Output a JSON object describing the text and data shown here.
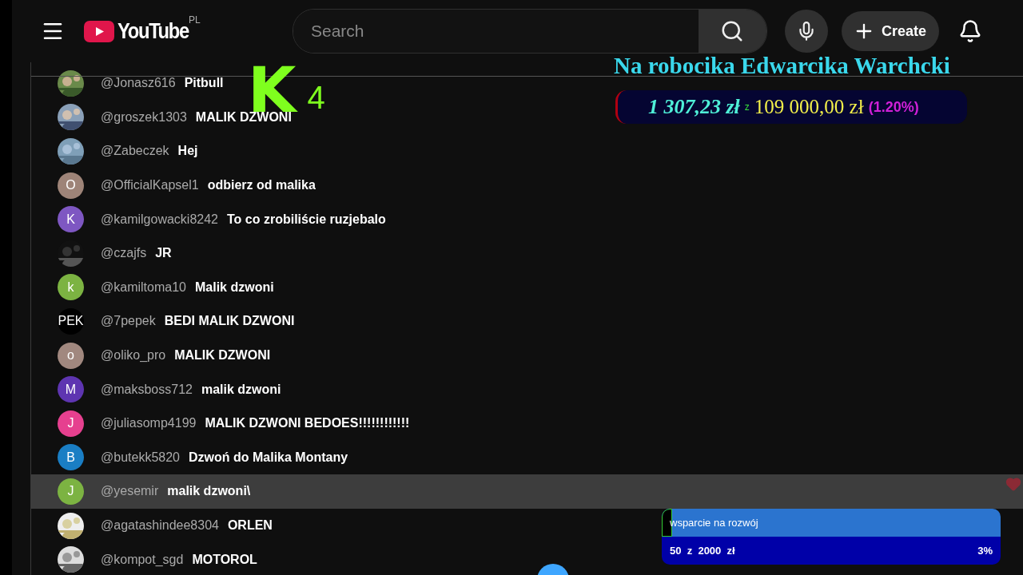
{
  "header": {
    "logo_text": "YouTube",
    "region": "PL",
    "search": {
      "placeholder": "Search"
    },
    "create_label": "Create"
  },
  "chat": {
    "messages": [
      {
        "author": "@Jonasz616",
        "text": "Pitbull",
        "selected": false
      },
      {
        "author": "@groszek1303",
        "text": "MALIK DZWONI",
        "selected": false
      },
      {
        "author": "@Zabeczek",
        "text": "Hej",
        "selected": false
      },
      {
        "author": "@OfficialKapsel1",
        "text": "odbierz od malika",
        "avatar": {
          "kind": "letter",
          "letter": "O",
          "color": "#9e8478"
        },
        "selected": false
      },
      {
        "author": "@kamilgowacki8242",
        "text": "To co zrobiliście ruzjebalo",
        "avatar": {
          "kind": "letter",
          "letter": "K",
          "color": "#7e57c2"
        },
        "selected": false
      },
      {
        "author": "@czajfs",
        "text": "JR",
        "selected": false
      },
      {
        "author": "@kamiltoma10",
        "text": "Malik dzwoni",
        "avatar": {
          "kind": "letter",
          "letter": "k",
          "color": "#7cb342"
        },
        "selected": false
      },
      {
        "author": "@7pepek",
        "text": "BEDI MALIK DZWONI",
        "avatar": {
          "kind": "letter",
          "letter": "PEK",
          "color": "#000000"
        },
        "selected": false
      },
      {
        "author": "@oliko_pro",
        "text": "MALIK DZWONI",
        "avatar": {
          "kind": "letter",
          "letter": "o",
          "color": "#a1887f"
        },
        "selected": false
      },
      {
        "author": "@maksboss712",
        "text": "malik dzwoni",
        "avatar": {
          "kind": "letter",
          "letter": "M",
          "color": "#5e35b1"
        },
        "selected": false
      },
      {
        "author": "@juliasomp4199",
        "text": "MALIK DZWONI BEDOES!!!!!!!!!!!!",
        "avatar": {
          "kind": "letter",
          "letter": "J",
          "color": "#e6408f"
        },
        "selected": false
      },
      {
        "author": "@butekk5820",
        "text": "Dzwoń do Malika Montany",
        "avatar": {
          "kind": "letter",
          "letter": "B",
          "color": "#1a7ec4"
        },
        "selected": false
      },
      {
        "author": "@yesemir",
        "text": "malik dzwoni\\",
        "avatar": {
          "kind": "letter",
          "letter": "J",
          "color": "#7cb342"
        },
        "selected": true
      },
      {
        "author": "@agatashindee8304",
        "text": "ORLEN",
        "selected": false
      },
      {
        "author": "@kompot_sgd",
        "text": "MOTOROL",
        "selected": false
      }
    ]
  },
  "stream_logo": {
    "letter": "K",
    "digit": "4"
  },
  "goal": {
    "title": "Na robocika Edwarcika Warchcki",
    "raised": "1 307,23 zł",
    "separator": "z",
    "target": "109 000,00 zł",
    "percent": "(1.20%)"
  },
  "support_bar": {
    "title": "wsparcie na rozwój",
    "amount": "50  z  2000  zł",
    "percent": "3%",
    "level": 0.03
  }
}
